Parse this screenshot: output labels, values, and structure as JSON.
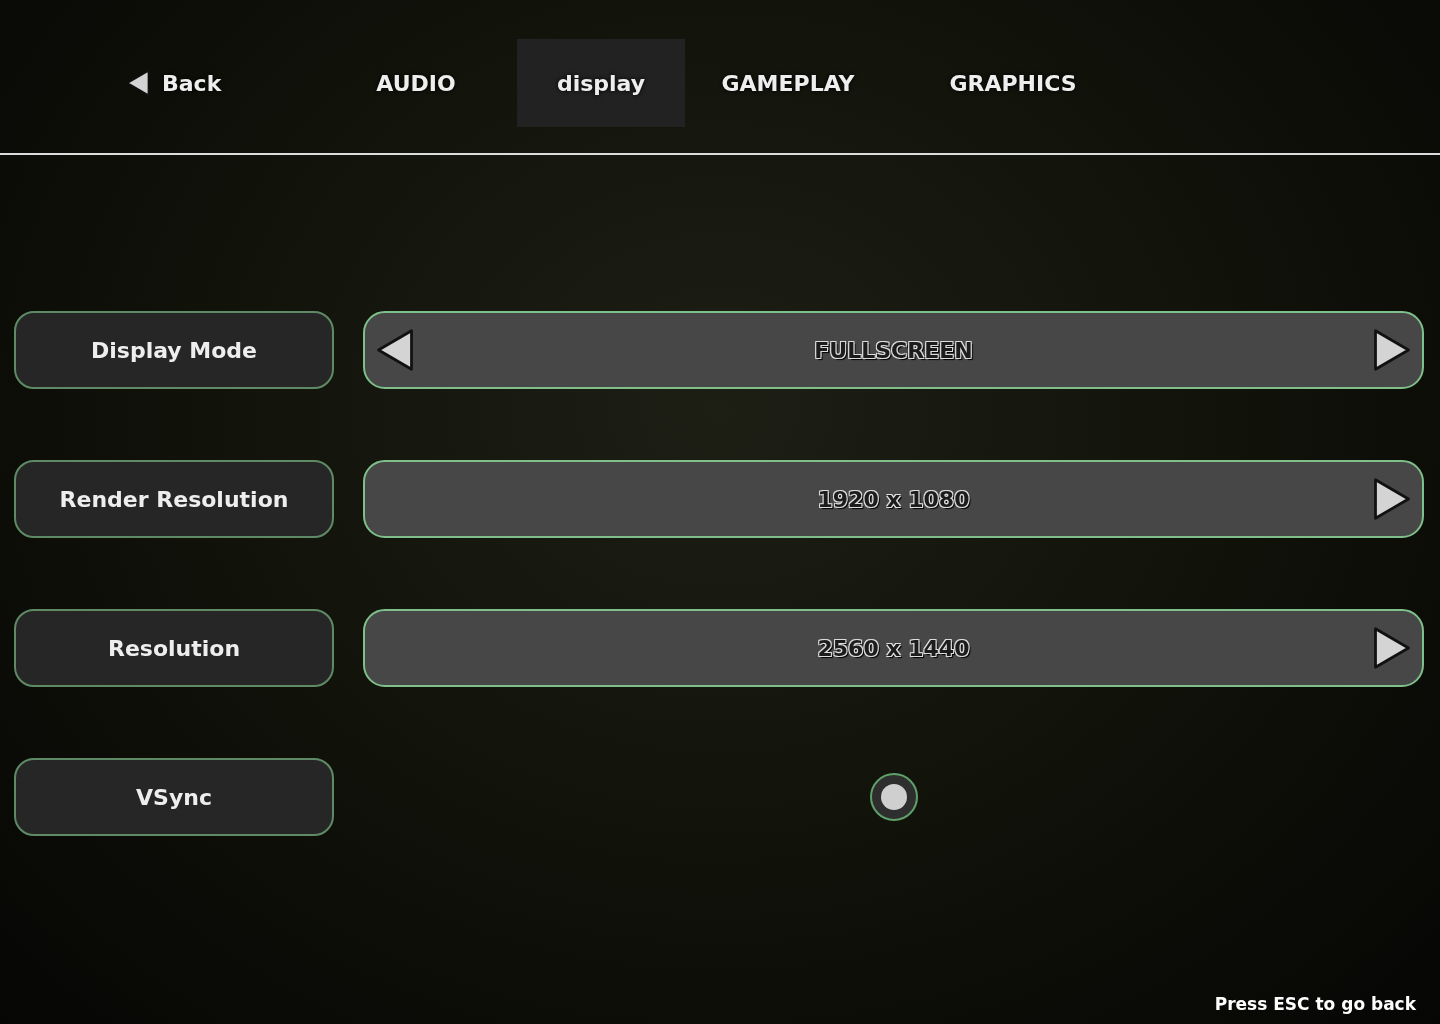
{
  "nav": {
    "back": {
      "label": "Back"
    },
    "tabs": [
      {
        "label": "AUDIO",
        "selected": false
      },
      {
        "label": "display",
        "selected": true
      },
      {
        "label": "GAMEPLAY",
        "selected": false
      },
      {
        "label": "GRAPHICS",
        "selected": false
      }
    ]
  },
  "settings": [
    {
      "kind": "selector",
      "label": "Display Mode",
      "value": "FULLSCREEN",
      "left_arrow": true,
      "right_arrow": true
    },
    {
      "kind": "selector",
      "label": "Render Resolution",
      "value": "1920 x 1080",
      "left_arrow": false,
      "right_arrow": true
    },
    {
      "kind": "selector",
      "label": "Resolution",
      "value": "2560 x 1440",
      "left_arrow": false,
      "right_arrow": true
    },
    {
      "kind": "toggle",
      "label": "VSync",
      "on": true
    }
  ],
  "footer_hint": "Press ESC to go back"
}
